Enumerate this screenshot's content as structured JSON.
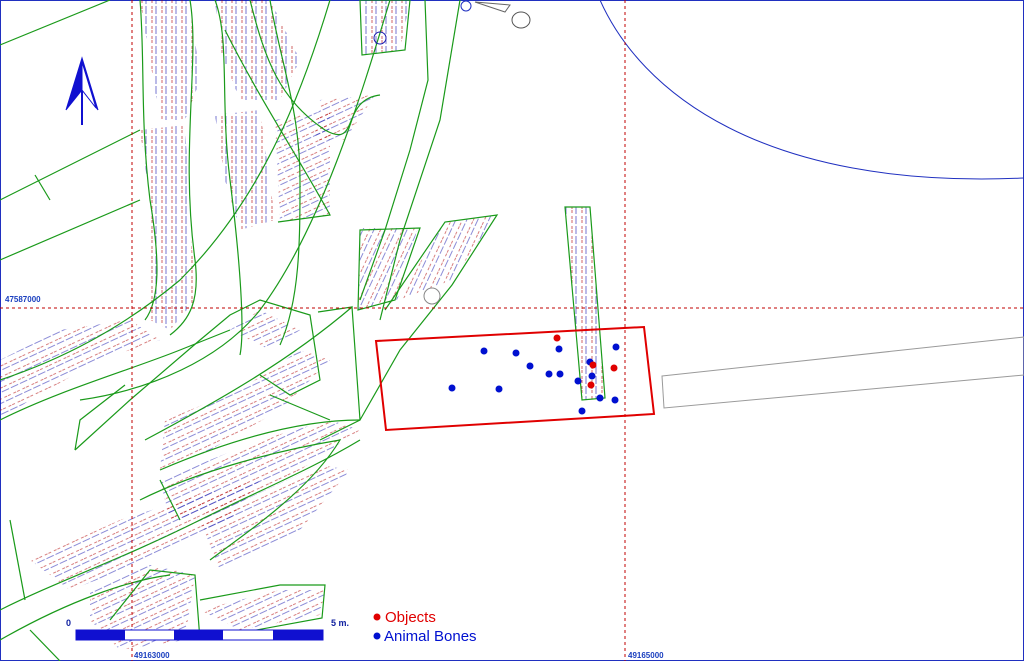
{
  "map": {
    "coordinates": {
      "northing": "47587000",
      "easting_left": "49163000",
      "easting_right": "49165000"
    },
    "scale_bar": {
      "start_label": "0",
      "end_label": "5 m."
    },
    "legend": [
      {
        "label": "Objects",
        "color": "#e00000"
      },
      {
        "label": "Animal Bones",
        "color": "#0010d0"
      }
    ],
    "north_arrow": "north-arrow-icon",
    "colors": {
      "grid": "#c00000",
      "trench_outline": "#1a9a1a",
      "study_area": "#e00000",
      "contour": "#2030c0",
      "object": "#e00000",
      "animal_bone": "#0010d0"
    },
    "finds": {
      "objects_count": 4,
      "animal_bones_count": 15
    }
  }
}
